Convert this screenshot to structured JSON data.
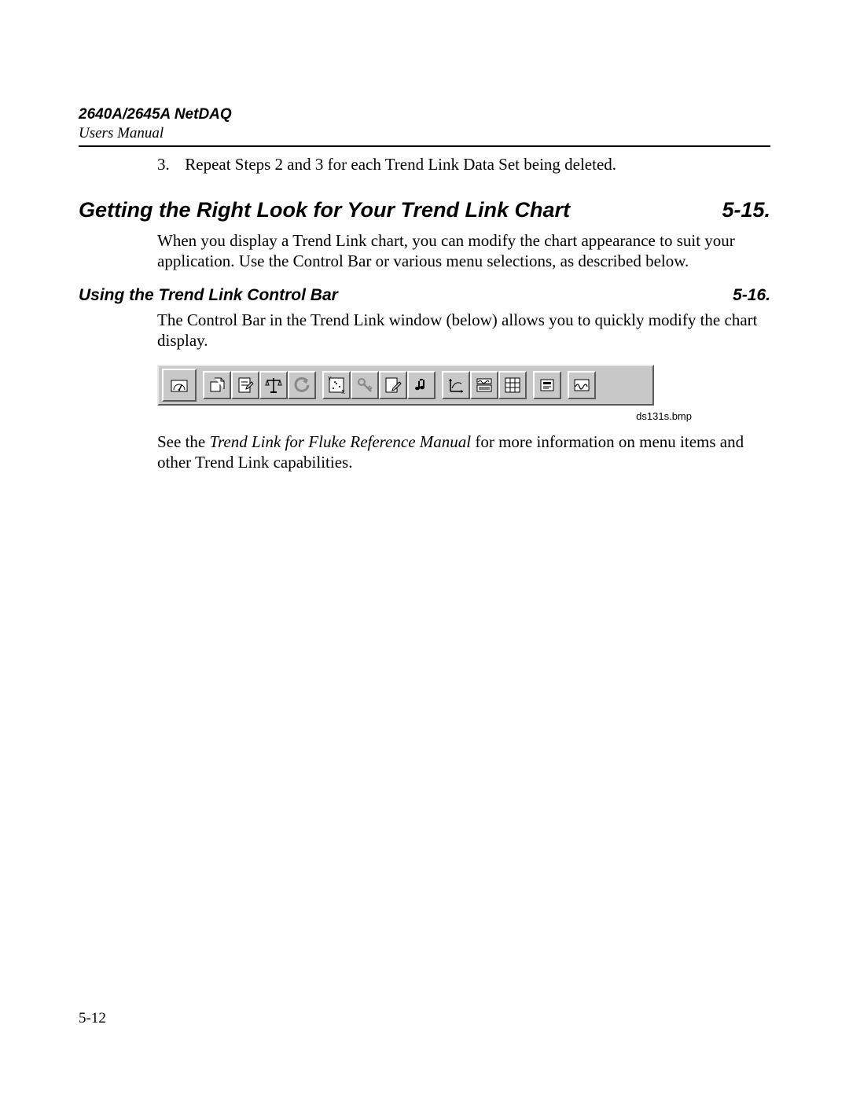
{
  "header": {
    "title": "2640A/2645A NetDAQ",
    "subtitle": "Users Manual"
  },
  "step": {
    "number": "3.",
    "text": "Repeat Steps 2 and 3 for each Trend Link Data Set being deleted."
  },
  "section1": {
    "title": "Getting the Right Look for Your Trend Link Chart",
    "number": "5-15.",
    "body": "When you display a Trend Link chart, you can modify the chart appearance to suit your application. Use the Control Bar or various menu selections, as described below."
  },
  "section2": {
    "title": "Using the Trend Link Control Bar",
    "number": "5-16.",
    "body": "The Control Bar in the Trend Link window (below) allows you to quickly modify the chart display."
  },
  "toolbar": {
    "caption": "ds131s.bmp",
    "icons": [
      "dashboard-gauge-icon",
      "file-new-icon",
      "document-edit-icon",
      "balance-scale-icon",
      "undo-arrow-icon",
      "xy-scatter-icon",
      "key-icon",
      "pencil-edit-icon",
      "music-note-icon",
      "axis-arrows-icon",
      "chart-window-icon",
      "grid-icon",
      "card-icon",
      "waveform-icon"
    ]
  },
  "refpara": {
    "pre": "See the ",
    "em": "Trend Link for Fluke Reference Manual",
    "post": " for more information on menu items and other Trend Link capabilities."
  },
  "pagenum": "5-12"
}
